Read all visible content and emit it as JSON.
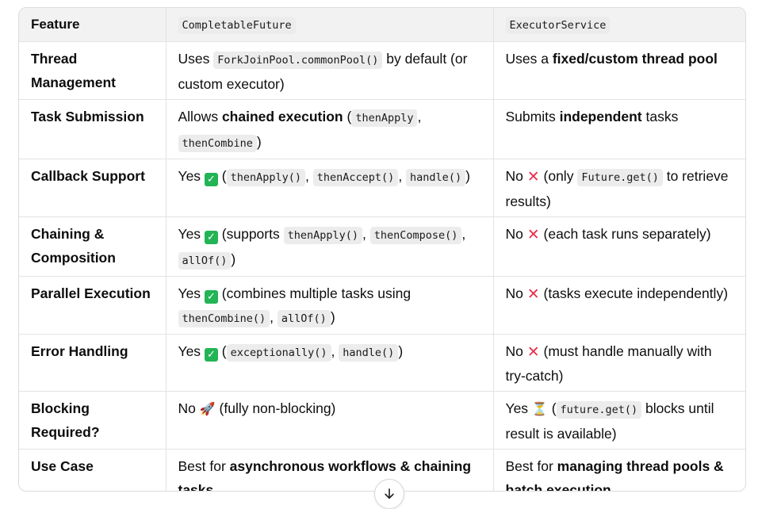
{
  "headers": {
    "feature": "Feature",
    "col_a": "CompletableFuture",
    "col_b": "ExecutorService"
  },
  "rows": [
    {
      "feature": "Thread Management",
      "a": [
        {
          "t": "text",
          "v": "Uses "
        },
        {
          "t": "code",
          "v": "ForkJoinPool.commonPool()"
        },
        {
          "t": "text",
          "v": " by default (or custom executor)"
        }
      ],
      "b": [
        {
          "t": "text",
          "v": "Uses a "
        },
        {
          "t": "bold",
          "v": "fixed/custom thread pool"
        }
      ]
    },
    {
      "feature": "Task Submission",
      "a": [
        {
          "t": "text",
          "v": "Allows "
        },
        {
          "t": "bold",
          "v": "chained execution"
        },
        {
          "t": "text",
          "v": " ("
        },
        {
          "t": "code",
          "v": "thenApply"
        },
        {
          "t": "text",
          "v": ", "
        },
        {
          "t": "code",
          "v": "thenCombine"
        },
        {
          "t": "text",
          "v": ")"
        }
      ],
      "b": [
        {
          "t": "text",
          "v": "Submits "
        },
        {
          "t": "bold",
          "v": "independent"
        },
        {
          "t": "text",
          "v": " tasks"
        }
      ]
    },
    {
      "feature": "Callback Support",
      "a": [
        {
          "t": "text",
          "v": "Yes "
        },
        {
          "t": "icon",
          "v": "check-icon"
        },
        {
          "t": "text",
          "v": " ("
        },
        {
          "t": "code",
          "v": "thenApply()"
        },
        {
          "t": "text",
          "v": ", "
        },
        {
          "t": "code",
          "v": "thenAccept()"
        },
        {
          "t": "text",
          "v": ", "
        },
        {
          "t": "code",
          "v": "handle()"
        },
        {
          "t": "text",
          "v": ")"
        }
      ],
      "b": [
        {
          "t": "text",
          "v": "No "
        },
        {
          "t": "icon",
          "v": "cross-icon"
        },
        {
          "t": "text",
          "v": " (only "
        },
        {
          "t": "code",
          "v": "Future.get()"
        },
        {
          "t": "text",
          "v": " to retrieve results)"
        }
      ]
    },
    {
      "feature": "Chaining & Composition",
      "a": [
        {
          "t": "text",
          "v": "Yes "
        },
        {
          "t": "icon",
          "v": "check-icon"
        },
        {
          "t": "text",
          "v": " (supports "
        },
        {
          "t": "code",
          "v": "thenApply()"
        },
        {
          "t": "text",
          "v": ", "
        },
        {
          "t": "code",
          "v": "thenCompose()"
        },
        {
          "t": "text",
          "v": ", "
        },
        {
          "t": "code",
          "v": "allOf()"
        },
        {
          "t": "text",
          "v": ")"
        }
      ],
      "b": [
        {
          "t": "text",
          "v": "No "
        },
        {
          "t": "icon",
          "v": "cross-icon"
        },
        {
          "t": "text",
          "v": " (each task runs separately)"
        }
      ]
    },
    {
      "feature": "Parallel Execution",
      "a": [
        {
          "t": "text",
          "v": "Yes "
        },
        {
          "t": "icon",
          "v": "check-icon"
        },
        {
          "t": "text",
          "v": " (combines multiple tasks using "
        },
        {
          "t": "code",
          "v": "thenCombine()"
        },
        {
          "t": "text",
          "v": ", "
        },
        {
          "t": "code",
          "v": "allOf()"
        },
        {
          "t": "text",
          "v": ")"
        }
      ],
      "b": [
        {
          "t": "text",
          "v": "No "
        },
        {
          "t": "icon",
          "v": "cross-icon"
        },
        {
          "t": "text",
          "v": " (tasks execute independently)"
        }
      ]
    },
    {
      "feature": "Error Handling",
      "a": [
        {
          "t": "text",
          "v": "Yes "
        },
        {
          "t": "icon",
          "v": "check-icon"
        },
        {
          "t": "text",
          "v": " ("
        },
        {
          "t": "code",
          "v": "exceptionally()"
        },
        {
          "t": "text",
          "v": ", "
        },
        {
          "t": "code",
          "v": "handle()"
        },
        {
          "t": "text",
          "v": ")"
        }
      ],
      "b": [
        {
          "t": "text",
          "v": "No "
        },
        {
          "t": "icon",
          "v": "cross-icon"
        },
        {
          "t": "text",
          "v": " (must handle manually with try-catch)"
        }
      ]
    },
    {
      "feature": "Blocking Required?",
      "a": [
        {
          "t": "text",
          "v": "No "
        },
        {
          "t": "icon",
          "v": "rocket-icon"
        },
        {
          "t": "text",
          "v": " (fully non-blocking)"
        }
      ],
      "b": [
        {
          "t": "text",
          "v": "Yes "
        },
        {
          "t": "icon",
          "v": "hourglass-icon"
        },
        {
          "t": "text",
          "v": " ("
        },
        {
          "t": "code",
          "v": "future.get()"
        },
        {
          "t": "text",
          "v": " blocks until result is available)"
        }
      ]
    },
    {
      "feature": "Use Case",
      "a": [
        {
          "t": "text",
          "v": "Best for "
        },
        {
          "t": "bold",
          "v": "asynchronous workflows & chaining tasks"
        }
      ],
      "b": [
        {
          "t": "text",
          "v": "Best for "
        },
        {
          "t": "bold",
          "v": "managing thread pools & batch execution"
        }
      ]
    }
  ],
  "icons": {
    "check": "✓",
    "cross": "✕",
    "rocket": "🚀",
    "hourglass": "⏳",
    "arrow_down": "↓"
  },
  "colors": {
    "check_bg": "#22b455",
    "cross": "#e8314f",
    "header_bg": "#f2f2f2"
  }
}
